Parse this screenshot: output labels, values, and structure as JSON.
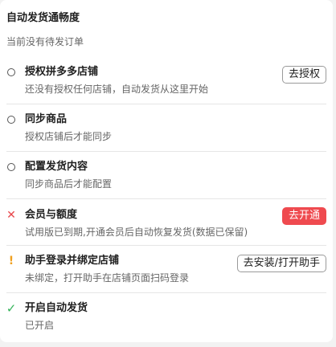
{
  "header": {
    "title": "自动发货通畅度",
    "subtitle": "当前没有待发订单"
  },
  "colors": {
    "danger": "#ef4a4f",
    "warning": "#f0a020",
    "success": "#34b45a"
  },
  "steps": [
    {
      "status_icon": "circle-icon",
      "title": "授权拼多多店铺",
      "description": "还没有授权任何店铺，自动发货从这里开始",
      "action_label": "去授权"
    },
    {
      "status_icon": "circle-icon",
      "title": "同步商品",
      "description": "授权店铺后才能同步"
    },
    {
      "status_icon": "circle-icon",
      "title": "配置发货内容",
      "description": "同步商品后才能配置"
    },
    {
      "status_icon": "cross-icon",
      "title": "会员与额度",
      "description": "试用版已到期,开通会员后自动恢复发货(数据已保留)",
      "action_label": "去开通"
    },
    {
      "status_icon": "exclamation-icon",
      "title": "助手登录并绑定店铺",
      "description": "未绑定，打开助手在店铺页面扫码登录",
      "action_label": "去安装/打开助手"
    },
    {
      "status_icon": "check-icon",
      "title": "开启自动发货",
      "description": "已开启"
    }
  ]
}
